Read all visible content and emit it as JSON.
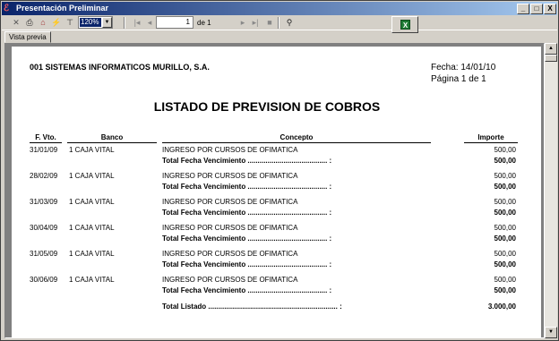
{
  "window": {
    "title": "Presentación Preliminar",
    "buttons": {
      "minimize": "_",
      "maximize": "□",
      "close": "X"
    }
  },
  "toolbar": {
    "zoom": "120%",
    "page_current": "1",
    "page_of": "de 1"
  },
  "tabs": [
    {
      "label": "Vista previa"
    }
  ],
  "report": {
    "company": "001 SISTEMAS INFORMATICOS MURILLO, S.A.",
    "fecha": "Fecha:  14/01/10",
    "pagina": "Página 1 de 1",
    "title": "LISTADO DE PREVISION DE COBROS",
    "headers": {
      "fvto": "F. Vto.",
      "banco": "Banco",
      "concepto": "Concepto",
      "importe": "Importe"
    },
    "rows": [
      {
        "fvto": "31/01/09",
        "banco": "1 CAJA VITAL",
        "concepto": "INGRESO POR CURSOS DE OFIMATICA",
        "importe": "500,00",
        "total_label": "Total Fecha Vencimiento ........................................ :",
        "total": "500,00"
      },
      {
        "fvto": "28/02/09",
        "banco": "1 CAJA VITAL",
        "concepto": "INGRESO POR CURSOS DE OFIMATICA",
        "importe": "500,00",
        "total_label": "Total Fecha Vencimiento ........................................ :",
        "total": "500,00"
      },
      {
        "fvto": "31/03/09",
        "banco": "1 CAJA VITAL",
        "concepto": "INGRESO POR CURSOS DE OFIMATICA",
        "importe": "500,00",
        "total_label": "Total Fecha Vencimiento ........................................ :",
        "total": "500,00"
      },
      {
        "fvto": "30/04/09",
        "banco": "1 CAJA VITAL",
        "concepto": "INGRESO POR CURSOS DE OFIMATICA",
        "importe": "500,00",
        "total_label": "Total Fecha Vencimiento ........................................ :",
        "total": "500,00"
      },
      {
        "fvto": "31/05/09",
        "banco": "1 CAJA VITAL",
        "concepto": "INGRESO POR CURSOS DE OFIMATICA",
        "importe": "500,00",
        "total_label": "Total Fecha Vencimiento ........................................ :",
        "total": "500,00"
      },
      {
        "fvto": "30/06/09",
        "banco": "1 CAJA VITAL",
        "concepto": "INGRESO POR CURSOS DE OFIMATICA",
        "importe": "500,00",
        "total_label": "Total Fecha Vencimiento ........................................ :",
        "total": "500,00"
      }
    ],
    "grand_total_label": "Total Listado ................................................................. :",
    "grand_total": "3.000,00"
  }
}
